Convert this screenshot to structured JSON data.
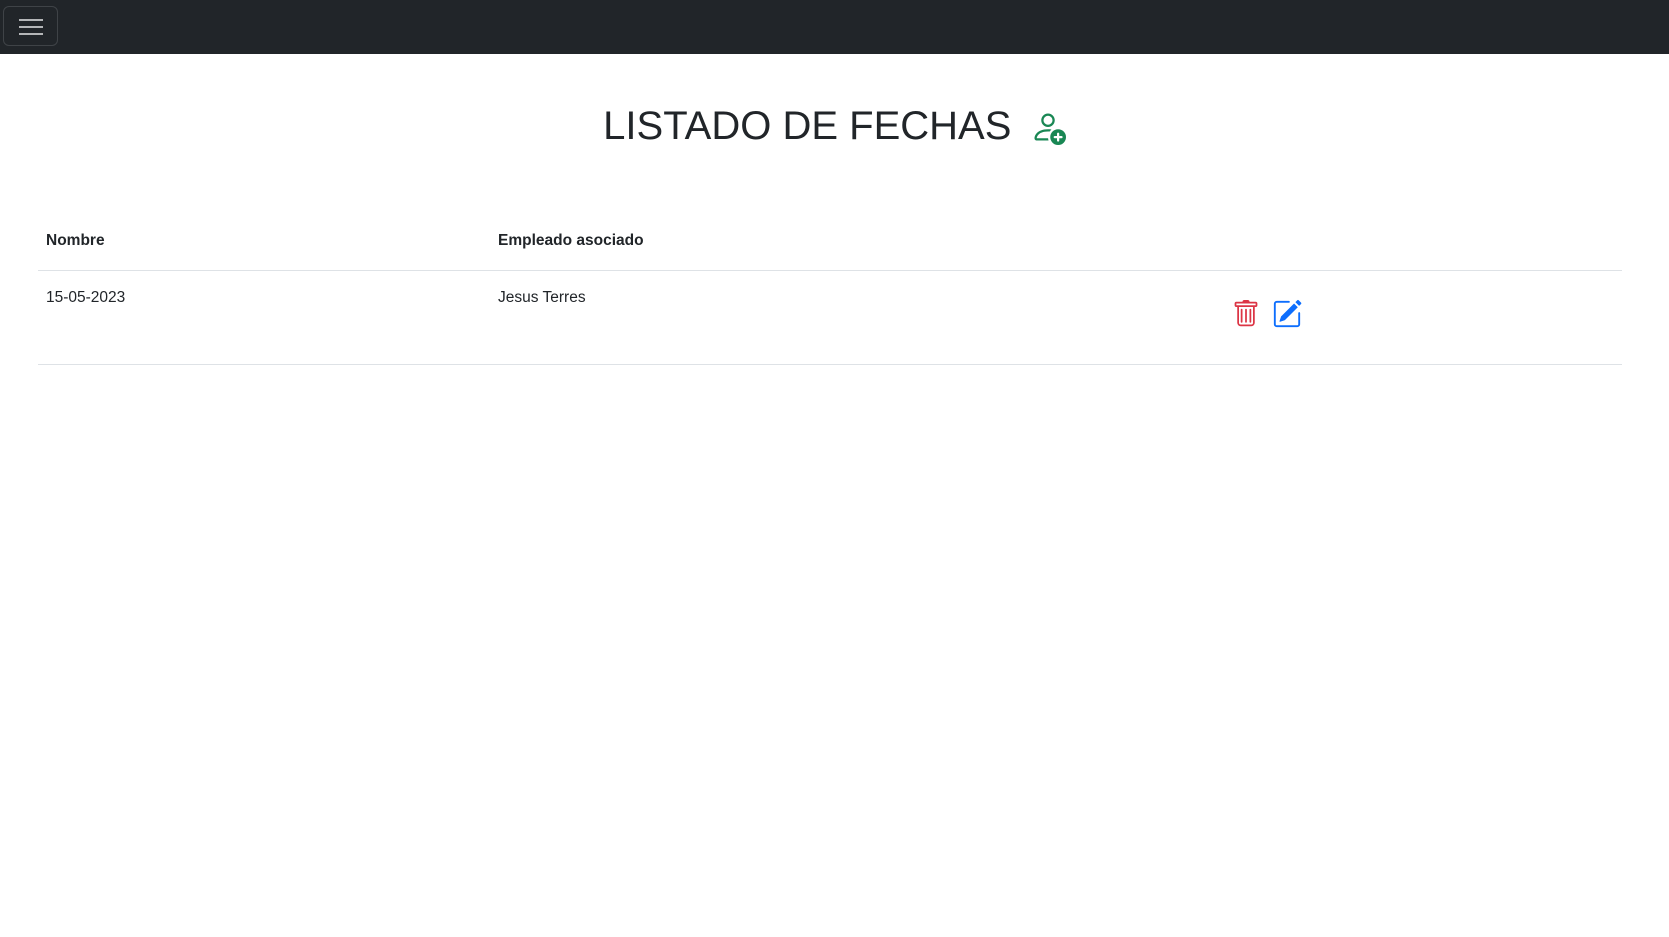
{
  "navbar": {
    "toggle_icon": "hamburger-icon"
  },
  "page": {
    "title": "LISTADO DE FECHAS",
    "add_icon": "person-plus-icon"
  },
  "table": {
    "headers": [
      "Nombre",
      "Empleado asociado",
      ""
    ],
    "rows": [
      {
        "nombre": "15-05-2023",
        "empleado": "Jesus Terres",
        "actions": [
          "trash-icon",
          "edit-icon"
        ]
      }
    ]
  },
  "colors": {
    "navbar": "#212529",
    "add": "#198754",
    "delete": "#dc3545",
    "edit": "#0d6efd"
  }
}
